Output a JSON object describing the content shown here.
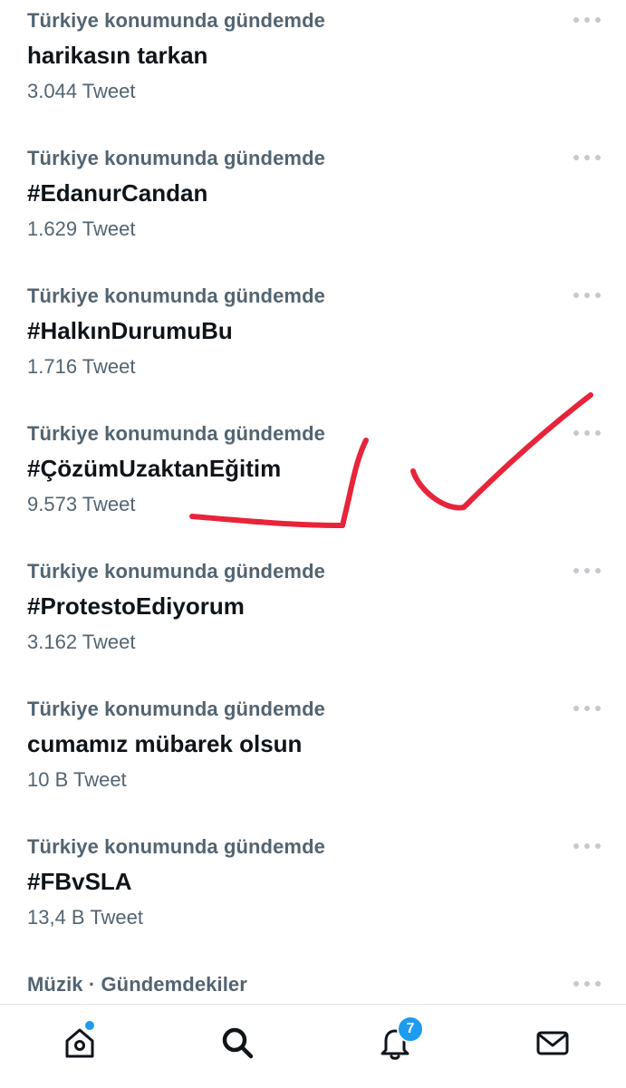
{
  "trends": [
    {
      "context": "Türkiye konumunda gündemde",
      "title": "harikasın tarkan",
      "count": "3.044 Tweet"
    },
    {
      "context": "Türkiye konumunda gündemde",
      "title": "#EdanurCandan",
      "count": "1.629 Tweet"
    },
    {
      "context": "Türkiye konumunda gündemde",
      "title": "#HalkınDurumuBu",
      "count": "1.716 Tweet"
    },
    {
      "context": "Türkiye konumunda gündemde",
      "title": "#ÇözümUzaktanEğitim",
      "count": "9.573 Tweet"
    },
    {
      "context": "Türkiye konumunda gündemde",
      "title": "#ProtestoEdiyorum",
      "count": "3.162 Tweet"
    },
    {
      "context": "Türkiye konumunda gündemde",
      "title": "cumamız mübarek olsun",
      "count": "10 B Tweet"
    },
    {
      "context": "Türkiye konumunda gündemde",
      "title": "#FBvSLA",
      "count": "13,4 B Tweet"
    },
    {
      "context": "Müzik · Gündemdekiler",
      "title": "",
      "count": ""
    }
  ],
  "tab_bar": {
    "items": [
      {
        "icon": "home-icon",
        "label": "Home"
      },
      {
        "icon": "search-icon",
        "label": "Search"
      },
      {
        "icon": "bell-icon",
        "label": "Notifications"
      },
      {
        "icon": "mail-icon",
        "label": "Messages"
      }
    ],
    "notification_badge": "7"
  },
  "colors": {
    "accent": "#1d9bf0",
    "secondary_text": "#536471",
    "annotation_marker": "#e8243a"
  }
}
